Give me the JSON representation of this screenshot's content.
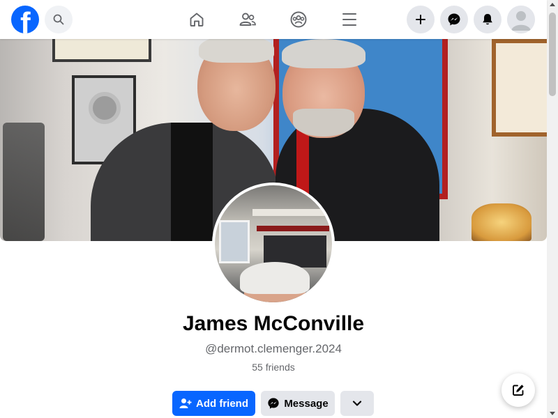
{
  "nav": {
    "logo_letter": "f",
    "items": [
      {
        "name": "home-icon"
      },
      {
        "name": "friends-icon"
      },
      {
        "name": "groups-icon"
      },
      {
        "name": "menu-icon"
      }
    ],
    "actions": [
      {
        "name": "create-button",
        "icon": "plus-icon"
      },
      {
        "name": "messenger-button",
        "icon": "messenger-icon"
      },
      {
        "name": "notifications-button",
        "icon": "bell-icon"
      }
    ]
  },
  "profile": {
    "name": "James McConville",
    "handle": "@dermot.clemenger.2024",
    "friends": "55 friends"
  },
  "actions": {
    "add_friend": "Add friend",
    "message": "Message"
  },
  "colors": {
    "brand": "#0866ff",
    "secondary_bg": "#e4e6eb",
    "muted_text": "#65676b"
  }
}
